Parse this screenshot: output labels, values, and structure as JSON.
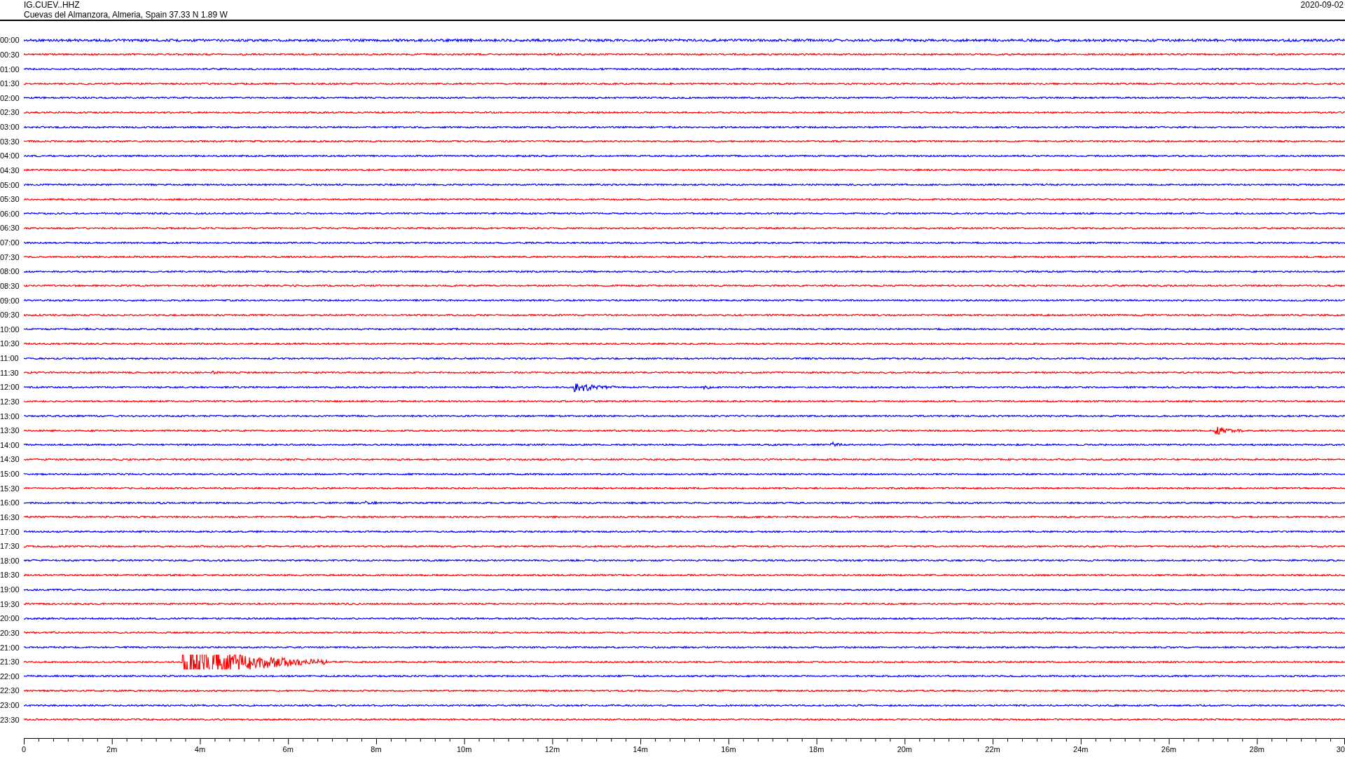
{
  "header": {
    "station": "IG.CUEV..HHZ",
    "location": "Cuevas del Almanzora, Almeria, Spain  37.33 N 1.89 W",
    "date": "2020-09-02"
  },
  "rows": [
    {
      "time": "00:00",
      "color": "#0000ff"
    },
    {
      "time": "00:30",
      "color": "#ff0000"
    },
    {
      "time": "01:00",
      "color": "#0000ff"
    },
    {
      "time": "01:30",
      "color": "#ff0000"
    },
    {
      "time": "02:00",
      "color": "#0000ff"
    },
    {
      "time": "02:30",
      "color": "#ff0000"
    },
    {
      "time": "03:00",
      "color": "#0000ff"
    },
    {
      "time": "03:30",
      "color": "#ff0000"
    },
    {
      "time": "04:00",
      "color": "#0000ff"
    },
    {
      "time": "04:30",
      "color": "#ff0000"
    },
    {
      "time": "05:00",
      "color": "#0000ff"
    },
    {
      "time": "05:30",
      "color": "#ff0000"
    },
    {
      "time": "06:00",
      "color": "#0000ff"
    },
    {
      "time": "06:30",
      "color": "#ff0000"
    },
    {
      "time": "07:00",
      "color": "#0000ff"
    },
    {
      "time": "07:30",
      "color": "#ff0000"
    },
    {
      "time": "08:00",
      "color": "#0000ff"
    },
    {
      "time": "08:30",
      "color": "#ff0000"
    },
    {
      "time": "09:00",
      "color": "#0000ff"
    },
    {
      "time": "09:30",
      "color": "#ff0000"
    },
    {
      "time": "10:00",
      "color": "#0000ff"
    },
    {
      "time": "10:30",
      "color": "#ff0000"
    },
    {
      "time": "11:00",
      "color": "#0000ff"
    },
    {
      "time": "11:30",
      "color": "#ff0000"
    },
    {
      "time": "12:00",
      "color": "#0000ff"
    },
    {
      "time": "12:30",
      "color": "#ff0000"
    },
    {
      "time": "13:00",
      "color": "#0000ff"
    },
    {
      "time": "13:30",
      "color": "#ff0000"
    },
    {
      "time": "14:00",
      "color": "#0000ff"
    },
    {
      "time": "14:30",
      "color": "#ff0000"
    },
    {
      "time": "15:00",
      "color": "#0000ff"
    },
    {
      "time": "15:30",
      "color": "#ff0000"
    },
    {
      "time": "16:00",
      "color": "#0000ff"
    },
    {
      "time": "16:30",
      "color": "#ff0000"
    },
    {
      "time": "17:00",
      "color": "#0000ff"
    },
    {
      "time": "17:30",
      "color": "#ff0000"
    },
    {
      "time": "18:00",
      "color": "#0000ff"
    },
    {
      "time": "18:30",
      "color": "#ff0000"
    },
    {
      "time": "19:00",
      "color": "#0000ff"
    },
    {
      "time": "19:30",
      "color": "#ff0000"
    },
    {
      "time": "20:00",
      "color": "#0000ff"
    },
    {
      "time": "20:30",
      "color": "#ff0000"
    },
    {
      "time": "21:00",
      "color": "#0000ff"
    },
    {
      "time": "21:30",
      "color": "#ff0000"
    },
    {
      "time": "22:00",
      "color": "#0000ff"
    },
    {
      "time": "22:30",
      "color": "#ff0000"
    },
    {
      "time": "23:00",
      "color": "#0000ff"
    },
    {
      "time": "23:30",
      "color": "#ff0000"
    }
  ],
  "axis": {
    "ticks": [
      "0",
      "2m",
      "4m",
      "6m",
      "8m",
      "10m",
      "12m",
      "14m",
      "16m",
      "18m",
      "20m",
      "22m",
      "24m",
      "26m",
      "28m",
      "30"
    ]
  }
}
